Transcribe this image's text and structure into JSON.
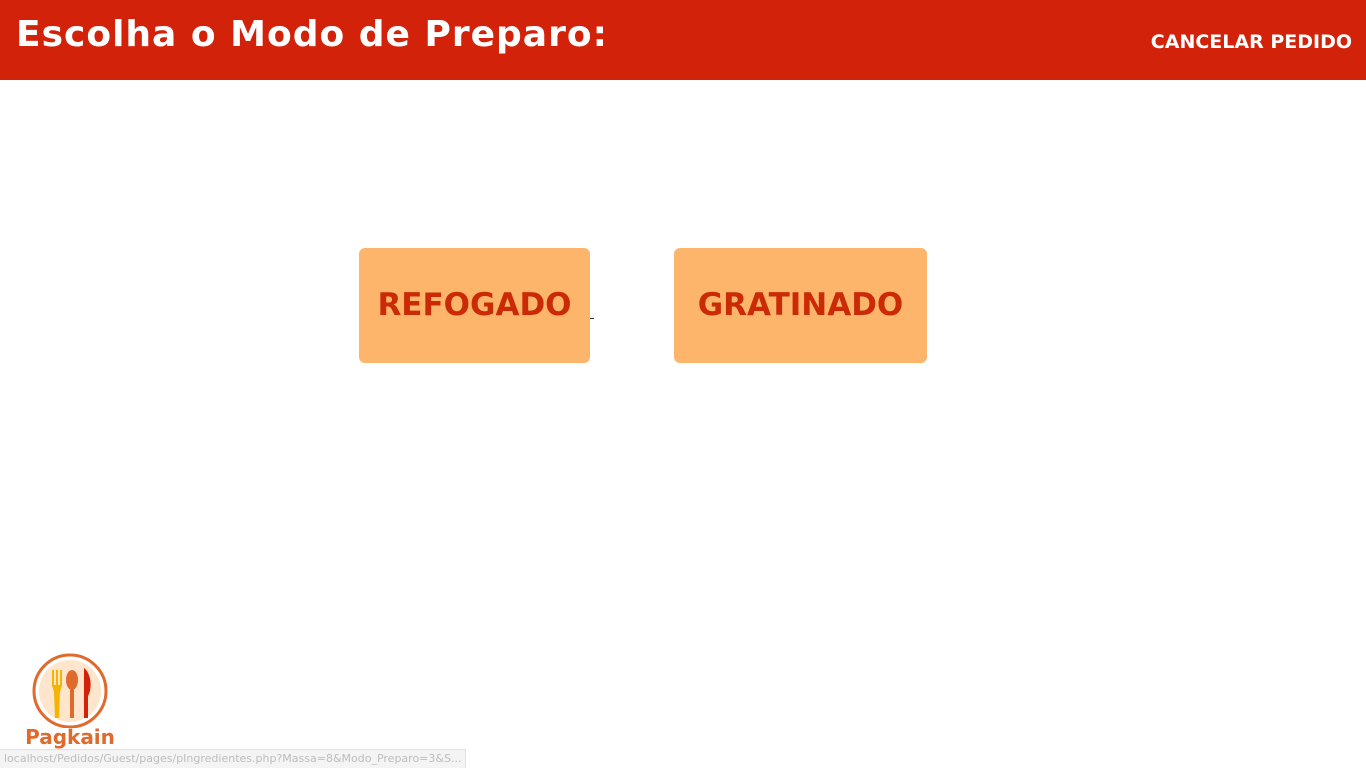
{
  "header": {
    "title": "Escolha o Modo de Preparo:",
    "cancel_label": "CANCELAR PEDIDO"
  },
  "options": [
    {
      "label": "REFOGADO"
    },
    {
      "label": "GRATINADO"
    }
  ],
  "logo": {
    "brand_name": "Pagkain",
    "icon": "fork-spoon-knife-icon"
  },
  "status_bar": {
    "url": "localhost/Pedidos/Guest/pages/pIngredientes.php?Massa=8&Modo_Preparo=3&S..."
  },
  "colors": {
    "header_bg": "#d2220a",
    "button_bg": "#fdb56b",
    "button_text": "#cb2a07",
    "logo_accent": "#e06a2c"
  }
}
